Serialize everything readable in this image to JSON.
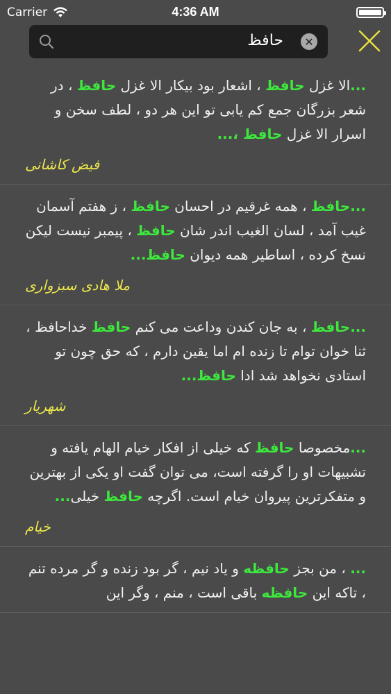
{
  "status_bar": {
    "carrier": "Carrier",
    "time": "4:36 AM"
  },
  "search": {
    "query": "حافظ"
  },
  "results": [
    {
      "segments": [
        {
          "t": "...",
          "h": true
        },
        {
          "t": "الا غزل ",
          "h": false
        },
        {
          "t": "حافظ",
          "h": true
        },
        {
          "t": " ، اشعار بود بیکار الا غزل ",
          "h": false
        },
        {
          "t": "حافظ",
          "h": true
        },
        {
          "t": " ، در شعر بزرگان جمع کم یابی تو این هر دو ، لطف سخن و اسرار الا غزل ",
          "h": false
        },
        {
          "t": "حافظ",
          "h": true
        },
        {
          "t": " ،...",
          "h": true
        }
      ],
      "author": "فیض کاشانی"
    },
    {
      "segments": [
        {
          "t": "...حافظ",
          "h": true
        },
        {
          "t": " ، همه غرقیم در احسان ",
          "h": false
        },
        {
          "t": "حافظ",
          "h": true
        },
        {
          "t": " ، ز هفتم آسمان غیب آمد ، لسان الغیب اندر شان ",
          "h": false
        },
        {
          "t": "حافظ",
          "h": true
        },
        {
          "t": " ، پیمبر نیست لیکن نسخ کرده ، اساطیر همه دیوان ",
          "h": false
        },
        {
          "t": "حافظ...",
          "h": true
        }
      ],
      "author": "ملا هادی سبزواری"
    },
    {
      "segments": [
        {
          "t": "...حافظ",
          "h": true
        },
        {
          "t": " ، به جان کندن وداعت می کنم ",
          "h": false
        },
        {
          "t": "حافظ",
          "h": true
        },
        {
          "t": " خداحافظ ، ثنا خوان توام تا زنده ام اما یقین دارم ، که حق چون تو استادی نخواهد شد ادا ",
          "h": false
        },
        {
          "t": "حافظ...",
          "h": true
        }
      ],
      "author": "شهریار"
    },
    {
      "segments": [
        {
          "t": "...",
          "h": true
        },
        {
          "t": "مخصوصا ",
          "h": false
        },
        {
          "t": "حافظ",
          "h": true
        },
        {
          "t": " که خیلی از افکار خیام الهام یافته و تشبیهات او را گرفته است، می توان گفت او یکی از بهترین و متفکرترین پیروان خیام است. اگرچه ",
          "h": false
        },
        {
          "t": "حافظ",
          "h": true
        },
        {
          "t": " خیلی",
          "h": false
        },
        {
          "t": "...",
          "h": true
        }
      ],
      "author": "خیام"
    },
    {
      "segments": [
        {
          "t": "...",
          "h": true
        },
        {
          "t": " ، من بجز ",
          "h": false
        },
        {
          "t": "حافظه",
          "h": true
        },
        {
          "t": " و یاد نیم ، گر بود زنده و گر مرده تنم ، تاکه این ",
          "h": false
        },
        {
          "t": "حافظه",
          "h": true
        },
        {
          "t": " باقی است ، منم ، وگر این",
          "h": false
        }
      ],
      "author": ""
    }
  ],
  "colors": {
    "highlight": "#3de83d",
    "author": "#ece64a",
    "accent": "#e8e03a"
  }
}
